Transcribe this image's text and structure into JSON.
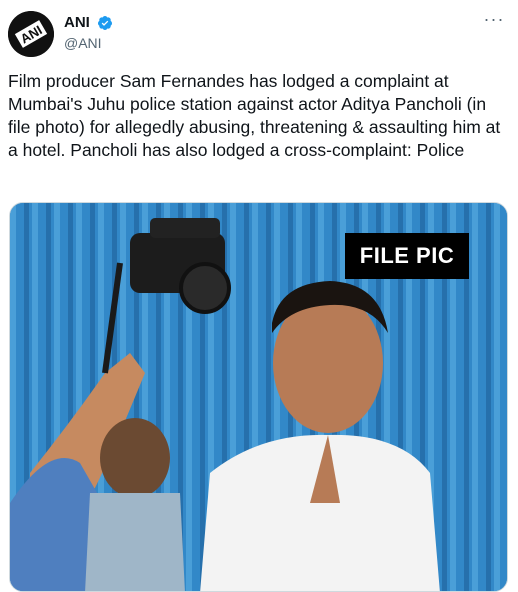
{
  "author": {
    "display_name": "ANI",
    "handle": "@ANI",
    "avatar_logo_text": "ANI"
  },
  "more_menu_glyph": "···",
  "tweet": {
    "text": "Film producer Sam Fernandes has lodged a complaint at Mumbai's Juhu police station against actor Aditya Pancholi (in file photo) for allegedly abusing, threatening & assaulting him at a hotel. Pancholi has also lodged a cross-complaint: Police"
  },
  "media": {
    "badge_text": "FILE PIC"
  },
  "colors": {
    "verified_blue": "#1d9bf0",
    "handle_gray": "#536471",
    "wall_blue": "#2f7fbf"
  }
}
